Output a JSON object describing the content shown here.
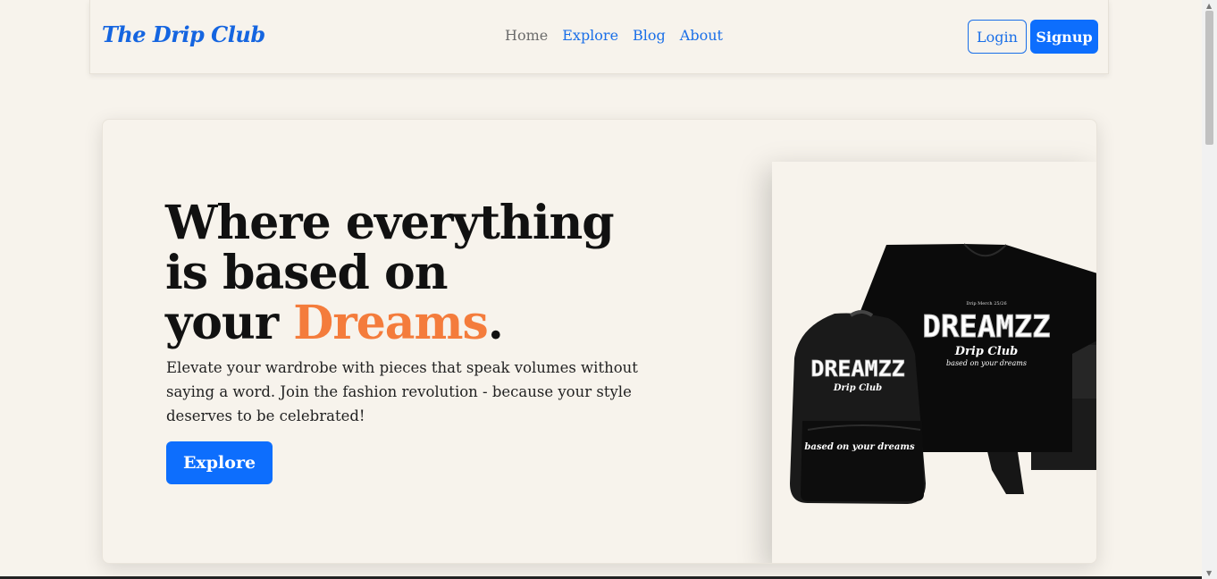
{
  "navbar": {
    "brand": "The Drip Club",
    "links": [
      {
        "label": "Home",
        "active": true
      },
      {
        "label": "Explore",
        "active": false
      },
      {
        "label": "Blog",
        "active": false
      },
      {
        "label": "About",
        "active": false
      }
    ],
    "login_label": "Login",
    "signup_label": "Signup"
  },
  "hero": {
    "headline_line1": "Where everything",
    "headline_line2": "is based on",
    "headline_line3_prefix": "your ",
    "headline_accent": "Dreams",
    "headline_suffix": ".",
    "description": "Elevate your wardrobe with pieces that speak volumes without saying a word. Join the fashion revolution - because your style deserves to be celebrated!",
    "explore_label": "Explore"
  },
  "product": {
    "brand_mark": "DREAMZZ",
    "sub_mark": "Drip Club",
    "tagline": "based on your dreams",
    "tiny_text": "Drip Merch 25/26"
  },
  "colors": {
    "background": "#f7f3ec",
    "primary": "#0d6efd",
    "accent": "#f47c3c",
    "brand": "#1565e0"
  }
}
